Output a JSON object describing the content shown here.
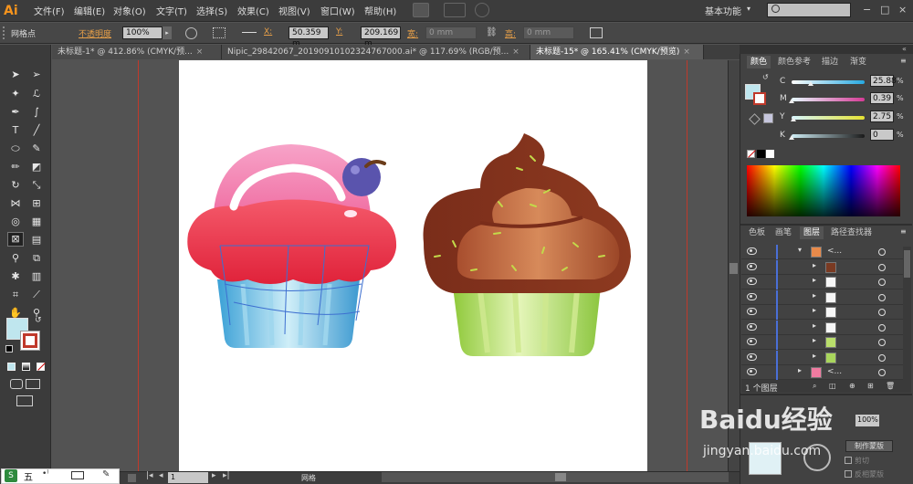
{
  "app": {
    "logo": "Ai",
    "workspace": "基本功能"
  },
  "menu": [
    "文件(F)",
    "编辑(E)",
    "对象(O)",
    "文字(T)",
    "选择(S)",
    "效果(C)",
    "视图(V)",
    "窗口(W)",
    "帮助(H)"
  ],
  "window_buttons": {
    "minimize": "−",
    "restore": "□",
    "close": "×"
  },
  "controlbar": {
    "selection_label": "网格点",
    "opacity_label": "不透明度",
    "opacity_value": "100%",
    "x_label": "X:",
    "x_value": "50.359 m",
    "y_label": "Y:",
    "y_value": "209.169 m",
    "w_label": "宽:",
    "w_value": "0 mm",
    "h_label": "高:",
    "h_value": "0 mm"
  },
  "doc_tabs": [
    {
      "label": "未标题-1* @ 412.86% (CMYK/预...",
      "close": "×"
    },
    {
      "label": "Nipic_29842067_20190910102324767000.ai* @ 117.69% (RGB/预...",
      "close": "×"
    },
    {
      "label": "未标题-15* @ 165.41% (CMYK/预览)",
      "close": "×"
    }
  ],
  "statusbar": {
    "zoom": "165.41%",
    "page": "1",
    "tool": "网格"
  },
  "color_panel": {
    "tabs": [
      "颜色",
      "颜色参考",
      "描边",
      "渐变"
    ],
    "channels": [
      {
        "name": "C",
        "value": "25.88",
        "pct": 0.26,
        "color": "#27a9e1"
      },
      {
        "name": "M",
        "value": "0.39",
        "pct": 0.0,
        "color": "#d63b96"
      },
      {
        "name": "Y",
        "value": "2.75",
        "pct": 0.03,
        "color": "#e5e232"
      },
      {
        "name": "K",
        "value": "0",
        "pct": 0.0,
        "color": "#1a1a1a"
      }
    ],
    "pct_sign": "%"
  },
  "layers_panel": {
    "tabs": [
      "色板",
      "画笔",
      "图层",
      "路径查找器"
    ],
    "rows": [
      {
        "label": "<...",
        "expanded": true
      },
      {
        "label": ""
      },
      {
        "label": ""
      },
      {
        "label": ""
      },
      {
        "label": ""
      },
      {
        "label": ""
      },
      {
        "label": ""
      },
      {
        "label": ""
      },
      {
        "label": "<..."
      }
    ],
    "footer": "1 个图层"
  },
  "transparency_panel": {
    "opacity_value": "100%",
    "make_mask": "制作蒙版",
    "clip": "剪切",
    "invert_mask": "反相蒙版"
  },
  "watermark": {
    "brand": "Baidu经验",
    "url": "jingyan.baidu.com"
  },
  "taskbar": {
    "ime": "五"
  }
}
